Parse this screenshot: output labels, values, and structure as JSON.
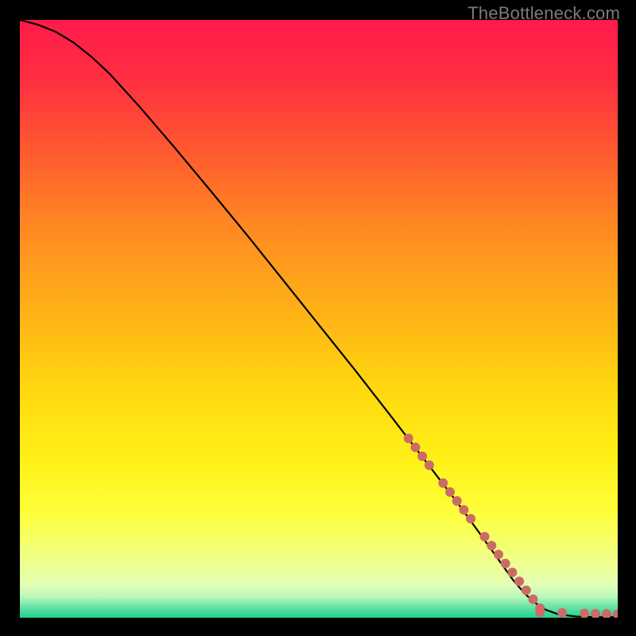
{
  "watermark": "TheBottleneck.com",
  "gradient": {
    "stops": [
      {
        "offset": 0.0,
        "color": "#ff1a4b"
      },
      {
        "offset": 0.1,
        "color": "#ff2f41"
      },
      {
        "offset": 0.22,
        "color": "#ff5a2f"
      },
      {
        "offset": 0.35,
        "color": "#ff8a22"
      },
      {
        "offset": 0.5,
        "color": "#ffb516"
      },
      {
        "offset": 0.62,
        "color": "#ffd80f"
      },
      {
        "offset": 0.74,
        "color": "#fff218"
      },
      {
        "offset": 0.83,
        "color": "#fdff3e"
      },
      {
        "offset": 0.9,
        "color": "#f0ff86"
      },
      {
        "offset": 0.945,
        "color": "#e2ffb6"
      },
      {
        "offset": 0.965,
        "color": "#baf7ba"
      },
      {
        "offset": 0.98,
        "color": "#6fe6a8"
      },
      {
        "offset": 1.0,
        "color": "#1fd08f"
      }
    ]
  },
  "chart_data": {
    "type": "line",
    "title": "",
    "xlabel": "",
    "ylabel": "",
    "xlim": [
      0,
      1
    ],
    "ylim": [
      0,
      1
    ],
    "series": [
      {
        "name": "curve",
        "x": [
          0.0,
          0.03,
          0.06,
          0.09,
          0.12,
          0.15,
          0.2,
          0.26,
          0.32,
          0.38,
          0.44,
          0.5,
          0.56,
          0.62,
          0.68,
          0.73,
          0.77,
          0.8,
          0.825,
          0.845,
          0.86,
          0.88,
          0.9,
          0.93,
          0.96,
          1.0
        ],
        "y": [
          1.0,
          0.992,
          0.98,
          0.962,
          0.938,
          0.91,
          0.855,
          0.785,
          0.713,
          0.64,
          0.565,
          0.49,
          0.415,
          0.338,
          0.26,
          0.195,
          0.14,
          0.098,
          0.063,
          0.04,
          0.026,
          0.013,
          0.006,
          0.002,
          0.001,
          0.001
        ]
      }
    ],
    "dotted_segments": [
      {
        "x0": 0.65,
        "y0": 0.3,
        "x1": 0.87,
        "y1": 0.016
      },
      {
        "x0": 0.87,
        "y0": 0.009,
        "x1": 1.0,
        "y1": 0.006
      }
    ],
    "dot_style": {
      "radius": 6,
      "gap": 14,
      "color": "#cc6b66"
    }
  }
}
